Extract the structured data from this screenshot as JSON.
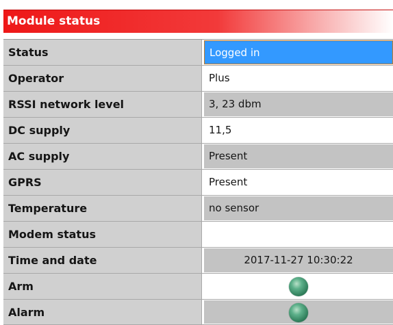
{
  "title": "Module status",
  "rows": [
    {
      "label": "Status",
      "value": "Logged in"
    },
    {
      "label": "Operator",
      "value": "Plus"
    },
    {
      "label": "RSSI network level",
      "value": "3, 23 dbm"
    },
    {
      "label": "DC supply",
      "value": "11,5"
    },
    {
      "label": "AC supply",
      "value": "Present"
    },
    {
      "label": "GPRS",
      "value": "Present"
    },
    {
      "label": "Temperature",
      "value": "no sensor"
    },
    {
      "label": "Modem status",
      "value": ""
    },
    {
      "label": "Time and date",
      "value": "2017-11-27 10:30:22"
    },
    {
      "label": "Arm",
      "value": ""
    },
    {
      "label": "Alarm",
      "value": ""
    }
  ],
  "colors": {
    "title_gradient_start": "#ee1818",
    "selected_value_bg": "#3399ff",
    "indicator_green": "#2f7d5a"
  },
  "indicators": {
    "arm": "green-led",
    "alarm": "green-led"
  }
}
